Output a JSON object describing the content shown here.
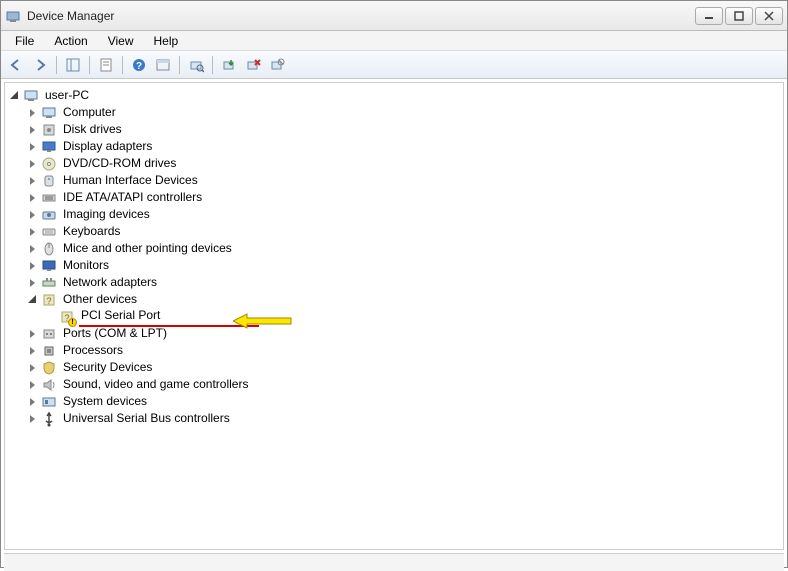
{
  "window": {
    "title": "Device Manager"
  },
  "menu": {
    "file": "File",
    "action": "Action",
    "view": "View",
    "help": "Help"
  },
  "tree": {
    "root": "user-PC",
    "items": [
      {
        "label": "Computer",
        "icon": "computer-icon"
      },
      {
        "label": "Disk drives",
        "icon": "disk-icon"
      },
      {
        "label": "Display adapters",
        "icon": "display-icon"
      },
      {
        "label": "DVD/CD-ROM drives",
        "icon": "dvd-icon"
      },
      {
        "label": "Human Interface Devices",
        "icon": "hid-icon"
      },
      {
        "label": "IDE ATA/ATAPI controllers",
        "icon": "ide-icon"
      },
      {
        "label": "Imaging devices",
        "icon": "imaging-icon"
      },
      {
        "label": "Keyboards",
        "icon": "keyboard-icon"
      },
      {
        "label": "Mice and other pointing devices",
        "icon": "mouse-icon"
      },
      {
        "label": "Monitors",
        "icon": "monitor-icon"
      },
      {
        "label": "Network adapters",
        "icon": "network-icon"
      },
      {
        "label": "Other devices",
        "icon": "other-icon",
        "expanded": true,
        "children": [
          {
            "label": "PCI Serial Port",
            "icon": "unknown-icon",
            "warning": true,
            "highlighted": true
          }
        ]
      },
      {
        "label": "Ports (COM & LPT)",
        "icon": "ports-icon"
      },
      {
        "label": "Processors",
        "icon": "cpu-icon"
      },
      {
        "label": "Security Devices",
        "icon": "security-icon"
      },
      {
        "label": "Sound, video and game controllers",
        "icon": "sound-icon"
      },
      {
        "label": "System devices",
        "icon": "system-icon"
      },
      {
        "label": "Universal Serial Bus controllers",
        "icon": "usb-icon"
      }
    ]
  }
}
